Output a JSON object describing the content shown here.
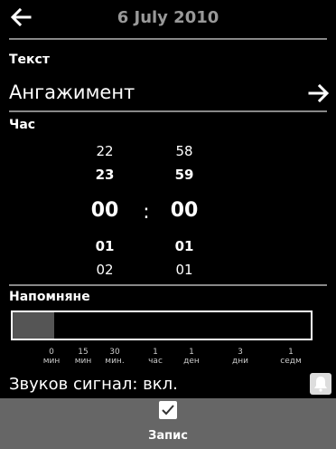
{
  "header": {
    "title": "6 July 2010",
    "back_icon": "arrow-left-icon"
  },
  "text_section": {
    "label": "Текст",
    "value": "Ангажимент",
    "open_icon": "arrow-right-icon"
  },
  "time_section": {
    "label": "Час",
    "hours": {
      "prev2": "22",
      "prev1": "23",
      "current": "00",
      "next1": "01",
      "next2": "02"
    },
    "minutes": {
      "prev2": "58",
      "prev1": "59",
      "current": "00",
      "next1": "01",
      "next2": "01"
    },
    "separator": ":"
  },
  "reminder_section": {
    "label": "Напомняне",
    "selected_index": 0,
    "scale": [
      {
        "num": "0",
        "unit": "мин"
      },
      {
        "num": "15",
        "unit": "мин"
      },
      {
        "num": "30",
        "unit": "мин."
      },
      {
        "num": "1",
        "unit": "час"
      },
      {
        "num": "1",
        "unit": "ден"
      },
      {
        "num": "3",
        "unit": "дни"
      },
      {
        "num": "1",
        "unit": "седм"
      }
    ]
  },
  "sound": {
    "label": "Звуков сигнал: вкл.",
    "icon": "bell-icon"
  },
  "footer": {
    "save_label": "Запис",
    "icon": "checkmark-icon"
  }
}
